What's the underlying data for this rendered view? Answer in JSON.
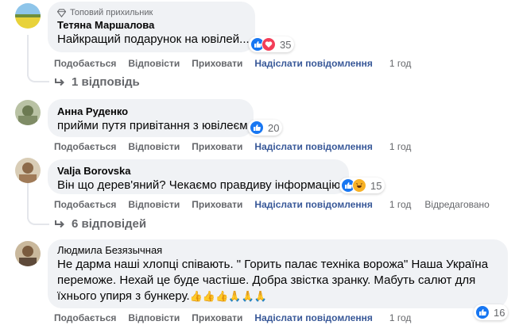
{
  "comments": [
    {
      "badge": "Топовий прихильник",
      "author": "Тетяна Маршалова",
      "text": "Найкращий подарунок на ювілей...",
      "reactions": [
        "like",
        "love"
      ],
      "reaction_count": "35",
      "actions": {
        "like": "Подобається",
        "reply": "Відповісти",
        "hide": "Приховати",
        "send": "Надіслати повідомлення",
        "time": "1 год"
      },
      "replies": "1 відповідь"
    },
    {
      "author": "Анна Руденко",
      "text": "прийми путя привітання з ювілеєм",
      "reactions": [
        "like"
      ],
      "reaction_count": "20",
      "actions": {
        "like": "Подобається",
        "reply": "Відповісти",
        "hide": "Приховати",
        "send": "Надіслати повідомлення",
        "time": "1 год"
      }
    },
    {
      "author": "Valja Borovska",
      "text": "Він що дерев'яний? Чекаємо правдиву інформацію.",
      "reactions": [
        "like",
        "haha"
      ],
      "reaction_count": "15",
      "actions": {
        "like": "Подобається",
        "reply": "Відповісти",
        "hide": "Приховати",
        "send": "Надіслати повідомлення",
        "time": "1 год",
        "edited": "Відредаговано"
      },
      "replies": "6 відповідей"
    },
    {
      "author": "Людмила Безязычная",
      "text_lines": [
        "Не дарма наші хлопці співають. \" Горить палає техніка ворожа\" Наша Україна",
        "переможе. Нехай це буде частіше. Добра звістка зранку. Мабуть салют для",
        "їхнього упиря з бункеру."
      ],
      "emoji": "👍👍👍🙏🙏🙏",
      "reactions": [
        "like"
      ],
      "reaction_count": "16",
      "actions": {
        "like": "Подобається",
        "reply": "Відповісти",
        "hide": "Приховати",
        "send": "Надіслати повідомлення",
        "time": "1 год"
      }
    }
  ],
  "colors": {
    "bubble": "#f0f2f5",
    "meta": "#65676b",
    "link": "#385898",
    "like": "#1877f2",
    "love": "#f33e58",
    "haha": "#f7b125"
  }
}
